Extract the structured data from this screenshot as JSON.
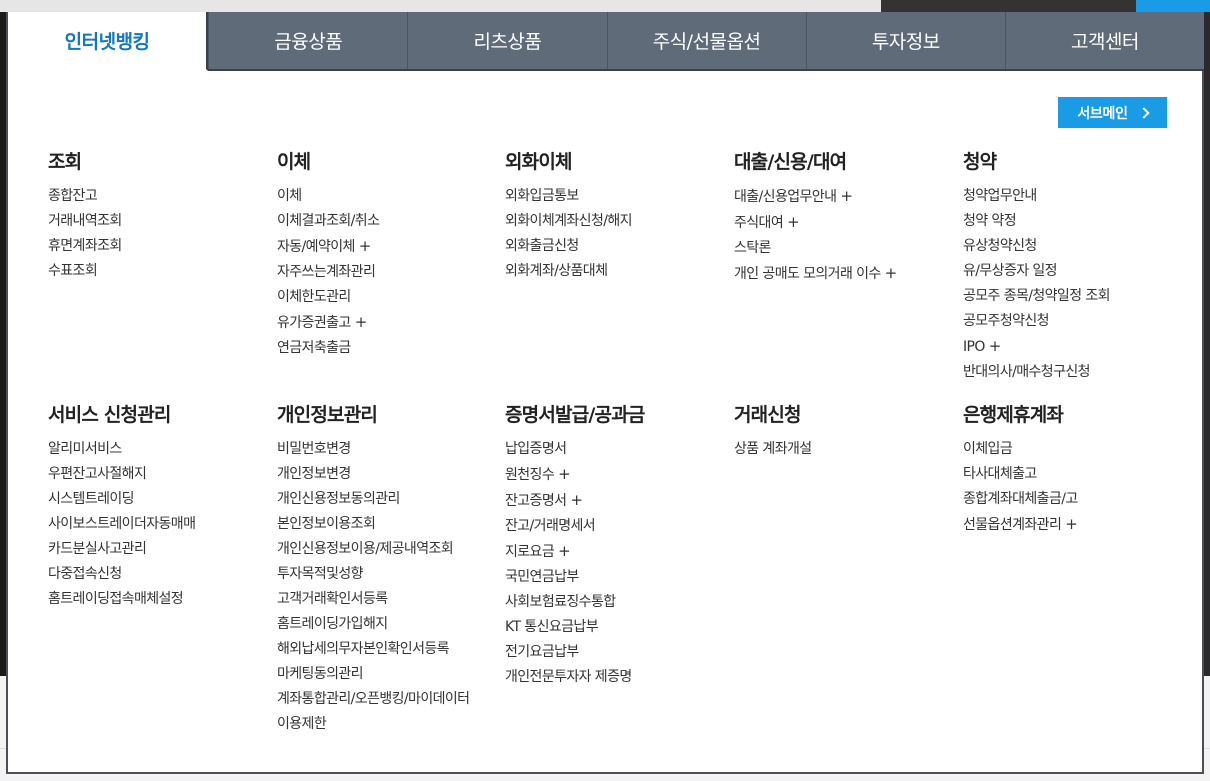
{
  "tabs": [
    {
      "label": "인터넷뱅킹"
    },
    {
      "label": "금융상품"
    },
    {
      "label": "리츠상품"
    },
    {
      "label": "주식/선물옵션"
    },
    {
      "label": "투자정보"
    },
    {
      "label": "고객센터"
    }
  ],
  "submain": {
    "label": "서브메인",
    "icon": "chevron-right-icon"
  },
  "plus_glyph": "+",
  "sections": [
    {
      "title": "조회",
      "items": [
        {
          "label": "종합잔고"
        },
        {
          "label": "거래내역조회"
        },
        {
          "label": "휴면계좌조회"
        },
        {
          "label": "수표조회"
        }
      ]
    },
    {
      "title": "이체",
      "items": [
        {
          "label": "이체"
        },
        {
          "label": "이체결과조회/취소"
        },
        {
          "label": "자동/예약이체",
          "expandable": true
        },
        {
          "label": "자주쓰는계좌관리"
        },
        {
          "label": "이체한도관리"
        },
        {
          "label": "유가증권출고",
          "expandable": true
        },
        {
          "label": "연금저축출금"
        }
      ]
    },
    {
      "title": "외화이체",
      "items": [
        {
          "label": "외화입금통보"
        },
        {
          "label": "외화이체계좌신청/해지"
        },
        {
          "label": "외화출금신청"
        },
        {
          "label": "외화계좌/상품대체"
        }
      ]
    },
    {
      "title": "대출/신용/대여",
      "items": [
        {
          "label": "대출/신용업무안내",
          "expandable": true
        },
        {
          "label": "주식대여",
          "expandable": true
        },
        {
          "label": "스탁론"
        },
        {
          "label": "개인 공매도 모의거래 이수",
          "expandable": true
        }
      ]
    },
    {
      "title": "청약",
      "items": [
        {
          "label": "청약업무안내"
        },
        {
          "label": "청약 약정"
        },
        {
          "label": "유상청약신청"
        },
        {
          "label": "유/무상증자 일정"
        },
        {
          "label": "공모주 종목/청약일정 조회"
        },
        {
          "label": "공모주청약신청"
        },
        {
          "label": "IPO",
          "expandable": true
        },
        {
          "label": "반대의사/매수청구신청"
        }
      ]
    },
    {
      "title": "서비스 신청관리",
      "items": [
        {
          "label": "알리미서비스"
        },
        {
          "label": "우편잔고사절해지"
        },
        {
          "label": "시스템트레이딩"
        },
        {
          "label": "사이보스트레이더자동매매"
        },
        {
          "label": "카드분실사고관리"
        },
        {
          "label": "다중접속신청"
        },
        {
          "label": "홈트레이딩접속매체설정"
        }
      ]
    },
    {
      "title": "개인정보관리",
      "items": [
        {
          "label": "비밀번호변경"
        },
        {
          "label": "개인정보변경"
        },
        {
          "label": "개인신용정보동의관리"
        },
        {
          "label": "본인정보이용조회"
        },
        {
          "label": "개인신용정보이용/제공내역조회"
        },
        {
          "label": "투자목적및성향"
        },
        {
          "label": "고객거래확인서등록"
        },
        {
          "label": "홈트레이딩가입해지"
        },
        {
          "label": "해외납세의무자본인확인서등록"
        },
        {
          "label": "마케팅동의관리"
        },
        {
          "label": "계좌통합관리/오픈뱅킹/마이데이터"
        },
        {
          "label": "이용제한"
        }
      ]
    },
    {
      "title": "증명서발급/공과금",
      "items": [
        {
          "label": "납입증명서"
        },
        {
          "label": "원천징수",
          "expandable": true
        },
        {
          "label": "잔고증명서",
          "expandable": true
        },
        {
          "label": "잔고/거래명세서"
        },
        {
          "label": "지로요금",
          "expandable": true
        },
        {
          "label": "국민연금납부"
        },
        {
          "label": "사회보험료징수통합"
        },
        {
          "label": "KT 통신요금납부"
        },
        {
          "label": "전기요금납부"
        },
        {
          "label": "개인전문투자자 제증명"
        }
      ]
    },
    {
      "title": "거래신청",
      "items": [
        {
          "label": "상품 계좌개설"
        }
      ]
    },
    {
      "title": "은행제휴계좌",
      "items": [
        {
          "label": "이체입금"
        },
        {
          "label": "타사대체출고"
        },
        {
          "label": "종합계좌대체출금/고"
        },
        {
          "label": "선물옵션계좌관리",
          "expandable": true
        }
      ]
    }
  ]
}
